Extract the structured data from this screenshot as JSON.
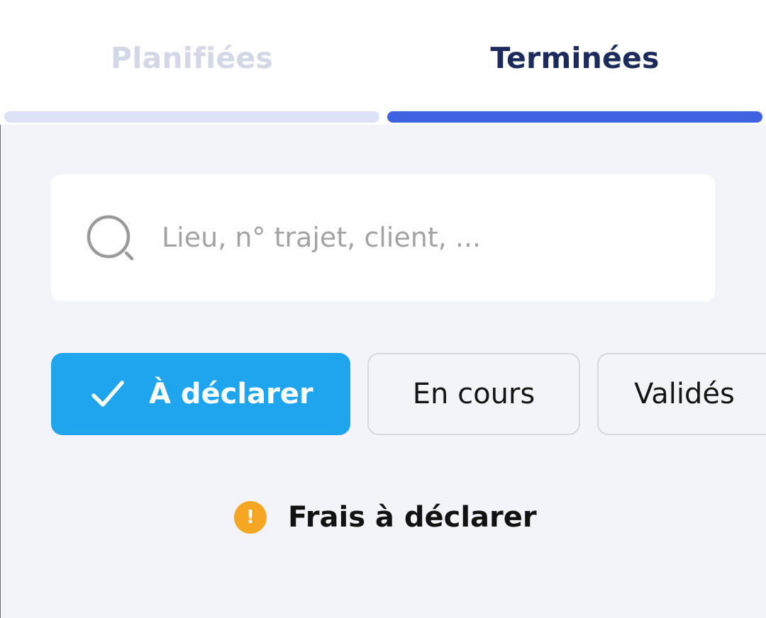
{
  "tabs": [
    {
      "label": "Planifiées",
      "selected": false,
      "label_color": "#d4d8e6",
      "underline_color": "#dde2f7"
    },
    {
      "label": "Terminées",
      "selected": true,
      "label_color": "#1a2b5c",
      "underline_color": "#3f63e0"
    }
  ],
  "search": {
    "placeholder": "Lieu, n° trajet, client, ...",
    "value": "",
    "icon": "search-icon"
  },
  "filters": [
    {
      "label": "À déclarer",
      "selected": true,
      "icon": "check-icon",
      "color": "#1ea5ee"
    },
    {
      "label": "En cours",
      "selected": false
    },
    {
      "label": "Validés",
      "selected": false
    }
  ],
  "notice": {
    "icon": "warning-icon",
    "icon_glyph": "!",
    "icon_color": "#f5a623",
    "text": "Frais à déclarer"
  },
  "colors": {
    "background": "#f3f4f9",
    "surface": "#ffffff",
    "accent": "#3f63e0"
  }
}
